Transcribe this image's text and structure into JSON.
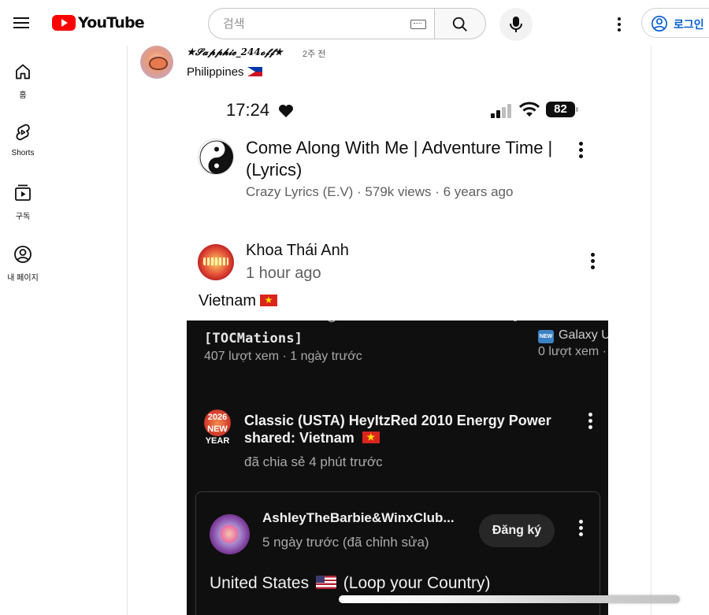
{
  "header": {
    "logo_text": "YouTube",
    "search_placeholder": "검색",
    "signin_label": "로그인"
  },
  "sidebar": {
    "items": [
      {
        "label": "홈",
        "icon": "home-icon"
      },
      {
        "label": "Shorts",
        "icon": "shorts-icon"
      },
      {
        "label": "구독",
        "icon": "subscriptions-icon"
      },
      {
        "label": "내 페이지",
        "icon": "account-icon"
      }
    ]
  },
  "post": {
    "author": "★𝓢𝓪𝓹𝓹𝓱𝓲𝓮_244𝓸𝓯𝓯★",
    "time": "2주 전",
    "text": "Philippines"
  },
  "phone": {
    "status_time": "17:24",
    "battery": "82",
    "video": {
      "title": "Come Along With Me | Adventure Time |(Lyrics)",
      "meta": "Crazy Lyrics (E.V) · 579k views · 6 years ago"
    },
    "comment": {
      "author": "Khoa Thái Anh",
      "time": "1 hour ago",
      "text": "Vietnam"
    },
    "inner": {
      "top_left_title": "[TOCMations]",
      "top_left_meta": "407 lượt xem · 1 ngày trước",
      "top_right_badge": "NEW",
      "top_right_title": "Galaxy U",
      "top_right_meta": "0 lượt xem ·",
      "share_avatar_text": "2026 NEW YEAR",
      "share_title": "Classic (USTA) HeyItzRed 2010 Energy Power shared: Vietnam",
      "share_meta": "đã chia sẻ 4 phút trước",
      "card_name": "AshleyTheBarbie&WinxClub...",
      "card_meta": "5 ngày trước (đã chỉnh sửa)",
      "subscribe_label": "Đăng ký",
      "card_text_before": "United States",
      "card_text_after": "(Loop your Country)"
    }
  }
}
